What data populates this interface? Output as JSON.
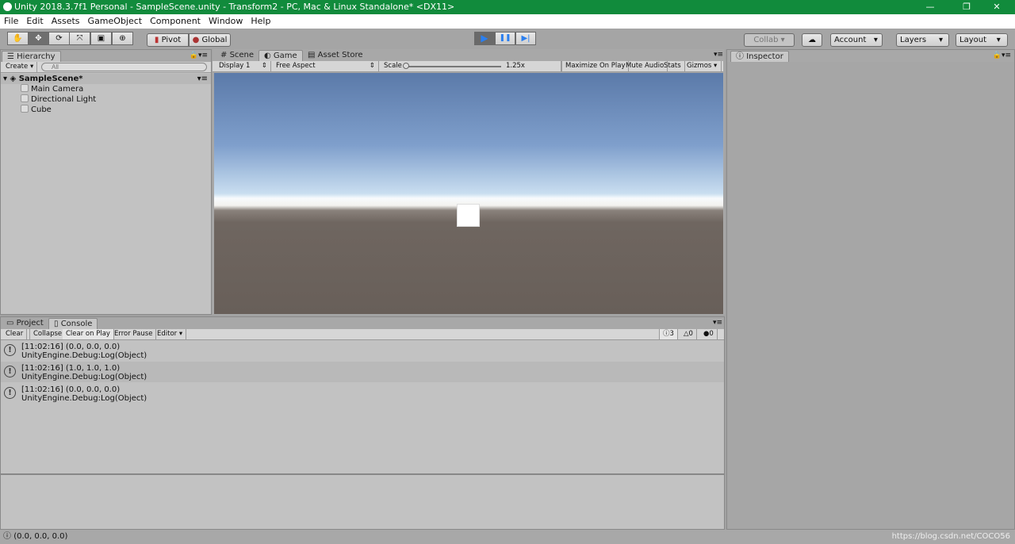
{
  "window": {
    "title": "Unity 2018.3.7f1 Personal - SampleScene.unity - Transform2 - PC, Mac & Linux Standalone* <DX11>",
    "minimize": "—",
    "restore": "❐",
    "close": "✕"
  },
  "menu": [
    "File",
    "Edit",
    "Assets",
    "GameObject",
    "Component",
    "Window",
    "Help"
  ],
  "toolbar": {
    "tools": [
      "hand-icon",
      "move-icon",
      "rotate-icon",
      "scale-icon",
      "rect-icon",
      "transform-icon"
    ],
    "active_tool": 1,
    "pivot": "Pivot",
    "global": "Global",
    "play": "▶",
    "pause": "❚❚",
    "step": "▶|",
    "collab": "Collab",
    "account": "Account",
    "layers": "Layers",
    "layout": "Layout"
  },
  "hierarchy": {
    "tab": "Hierarchy",
    "create": "Create",
    "search_placeholder": "All",
    "scene": "SampleScene*",
    "items": [
      "Main Camera",
      "Directional Light",
      "Cube"
    ]
  },
  "game": {
    "tabs": [
      "Scene",
      "Game",
      "Asset Store"
    ],
    "active_tab": 1,
    "display": "Display 1",
    "aspect": "Free Aspect",
    "scale_label": "Scale",
    "scale_value": "1.25x",
    "maximize": "Maximize On Play",
    "mute": "Mute Audio",
    "stats": "Stats",
    "gizmos": "Gizmos"
  },
  "inspector": {
    "tab": "Inspector"
  },
  "console": {
    "tabs": [
      "Project",
      "Console"
    ],
    "active_tab": 1,
    "buttons": [
      "Clear",
      "Collapse",
      "Clear on Play",
      "Error Pause",
      "Editor"
    ],
    "counts": {
      "log": "3",
      "warning": "0",
      "error": "0"
    },
    "logs": [
      {
        "line1": "[11:02:16] (0.0, 0.0, 0.0)",
        "line2": "UnityEngine.Debug:Log(Object)"
      },
      {
        "line1": "[11:02:16] (1.0, 1.0, 1.0)",
        "line2": "UnityEngine.Debug:Log(Object)"
      },
      {
        "line1": "[11:02:16] (0.0, 0.0, 0.0)",
        "line2": "UnityEngine.Debug:Log(Object)"
      }
    ]
  },
  "status": {
    "message": "(0.0, 0.0, 0.0)",
    "watermark": "https://blog.csdn.net/COCO56"
  }
}
